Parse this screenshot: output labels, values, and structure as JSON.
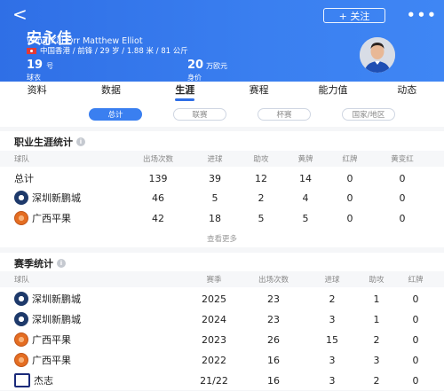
{
  "header": {
    "back_glyph": "<",
    "follow_label": "+ 关注",
    "more_glyph": "•••",
    "player_name": "安永佳",
    "player_name_en": "Wing-Kai Orr Matthew Elliot",
    "player_info": "中国香港 / 前锋 / 29 岁 / 1.88 米 / 81 公斤",
    "jersey_number": "19",
    "jersey_unit": "号",
    "jersey_label": "球衣",
    "market_value": "20",
    "market_value_unit": "万欧元",
    "market_value_label": "身价"
  },
  "tabs": [
    {
      "label": "资料",
      "active": false
    },
    {
      "label": "数据",
      "active": false
    },
    {
      "label": "生涯",
      "active": true
    },
    {
      "label": "赛程",
      "active": false
    },
    {
      "label": "能力值",
      "active": false
    },
    {
      "label": "动态",
      "active": false
    }
  ],
  "filters": [
    {
      "label": "总计",
      "active": true
    },
    {
      "label": "联赛",
      "active": false
    },
    {
      "label": "杯赛",
      "active": false
    },
    {
      "label": "国家/地区",
      "active": false
    }
  ],
  "career": {
    "title": "职业生涯统计",
    "info_glyph": "i",
    "headers": [
      "球队",
      "出场次数",
      "进球",
      "助攻",
      "黄牌",
      "红牌",
      "黄变红"
    ],
    "rows": [
      {
        "team": "总计",
        "logo": "none",
        "apps": "139",
        "goals": "39",
        "assists": "12",
        "yellow": "14",
        "red": "0",
        "second_yellow": "0"
      },
      {
        "team": "深圳新鹏城",
        "logo": "sz",
        "apps": "46",
        "goals": "5",
        "assists": "2",
        "yellow": "4",
        "red": "0",
        "second_yellow": "0"
      },
      {
        "team": "广西平果",
        "logo": "gx",
        "apps": "42",
        "goals": "18",
        "assists": "5",
        "yellow": "5",
        "red": "0",
        "second_yellow": "0"
      }
    ],
    "view_more": "查看更多"
  },
  "season": {
    "title": "赛季统计",
    "info_glyph": "i",
    "headers": [
      "球队",
      "赛季",
      "出场次数",
      "进球",
      "助攻",
      "红牌"
    ],
    "rows": [
      {
        "team": "深圳新鹏城",
        "logo": "sz",
        "season": "2025",
        "apps": "23",
        "goals": "2",
        "assists": "1",
        "red": "0"
      },
      {
        "team": "深圳新鹏城",
        "logo": "sz",
        "season": "2024",
        "apps": "23",
        "goals": "3",
        "assists": "1",
        "red": "0"
      },
      {
        "team": "广西平果",
        "logo": "gx",
        "season": "2023",
        "apps": "26",
        "goals": "15",
        "assists": "2",
        "red": "0"
      },
      {
        "team": "广西平果",
        "logo": "gx",
        "season": "2022",
        "apps": "16",
        "goals": "3",
        "assists": "3",
        "red": "0"
      },
      {
        "team": "杰志",
        "logo": "jz",
        "season": "21/22",
        "apps": "16",
        "goals": "3",
        "assists": "2",
        "red": "0"
      }
    ]
  },
  "colors": {
    "accent": "#3a7ff0",
    "header_bg": "#2f6fe6"
  }
}
